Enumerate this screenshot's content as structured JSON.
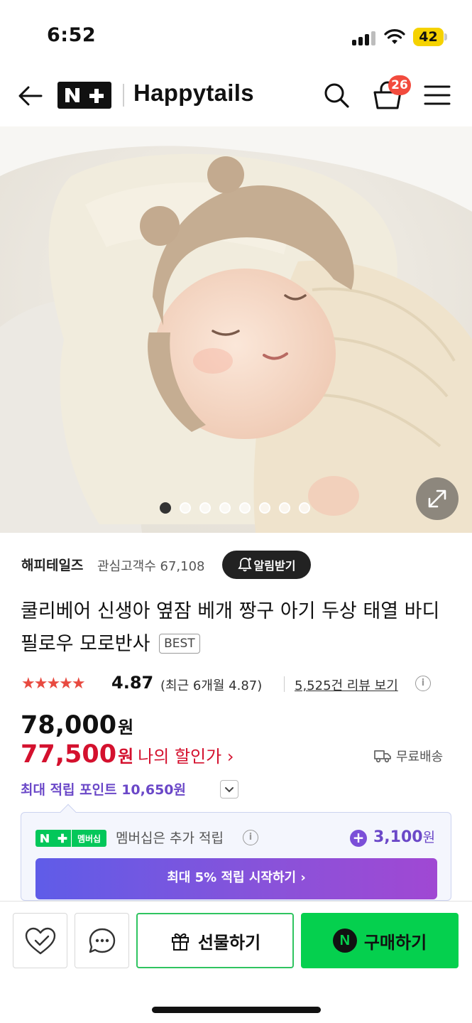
{
  "status_bar": {
    "time": "6:52",
    "battery": "42"
  },
  "header": {
    "logo": "N+",
    "brand": "Happytails",
    "cart_count": "26"
  },
  "hero": {
    "image_count": 8,
    "active_index": 0
  },
  "seller": {
    "name": "해피테일즈",
    "followers": "관심고객수 67,108",
    "alarm_label": "알림받기"
  },
  "product": {
    "title": "쿨리베어 신생아 옆잠 베개 짱구 아기 두상 태열 바디필로우 모로반사",
    "badge": "BEST",
    "rating": 5,
    "score": "4.87",
    "recent": "(최근 6개월 4.87)",
    "reviews": "5,525건 리뷰 보기",
    "price": "78,000",
    "price_unit": "원",
    "sale_price": "77,500",
    "sale_label": "나의 할인가 ›",
    "shipping": "무료배송",
    "max_points": "최대 적립 포인트 10,650원"
  },
  "membership": {
    "badge": "멤버십",
    "text": "멤버십은 추가 적립",
    "points": "3,100",
    "points_unit": "원",
    "cta": "최대 5% 적립 시작하기 ›"
  },
  "actions": {
    "gift": "선물하기",
    "buy": "구매하기"
  },
  "colors": {
    "accent_green": "#05d04e",
    "sale_red": "#d4112e",
    "points_purple": "#6b48c8"
  }
}
